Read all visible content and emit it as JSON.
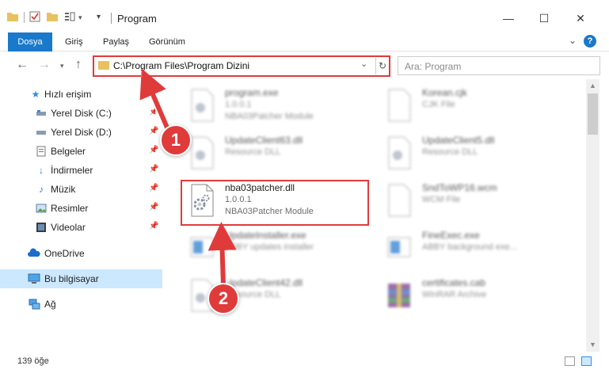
{
  "window": {
    "title": "Program",
    "minimize_icon": "minimize-icon",
    "maximize_icon": "maximize-icon",
    "close_icon": "close-icon"
  },
  "ribbon": {
    "tabs": [
      "Dosya",
      "Giriş",
      "Paylaş",
      "Görünüm"
    ],
    "help_label": "?"
  },
  "nav": {
    "address": "C:\\Program Files\\Program Dizini",
    "search_placeholder": "Ara: Program"
  },
  "sidebar": {
    "items": [
      {
        "label": "Hızlı erişim",
        "icon": "star-icon",
        "pinned": false
      },
      {
        "label": "Yerel Disk (C:)",
        "icon": "drive-icon",
        "pinned": true
      },
      {
        "label": "Yerel Disk (D:)",
        "icon": "drive-icon",
        "pinned": true
      },
      {
        "label": "Belgeler",
        "icon": "document-icon",
        "pinned": true
      },
      {
        "label": "İndirmeler",
        "icon": "download-icon",
        "pinned": true
      },
      {
        "label": "Müzik",
        "icon": "music-icon",
        "pinned": true
      },
      {
        "label": "Resimler",
        "icon": "picture-icon",
        "pinned": true
      },
      {
        "label": "Videolar",
        "icon": "video-icon",
        "pinned": true
      },
      {
        "label": "OneDrive",
        "icon": "cloud-icon",
        "pinned": false
      },
      {
        "label": "Bu bilgisayar",
        "icon": "computer-icon",
        "pinned": false,
        "selected": true
      },
      {
        "label": "Ağ",
        "icon": "network-icon",
        "pinned": false
      }
    ]
  },
  "files": [
    {
      "name": "program.exe",
      "ver": "1.0.0.1",
      "desc": "NBA03Patcher Module",
      "blurred": true
    },
    {
      "name": "Korean.cjk",
      "ver": "CJK File",
      "desc": "",
      "blurred": true
    },
    {
      "name": "UpdateClient63.dll",
      "ver": "Resource DLL",
      "desc": "",
      "blurred": true
    },
    {
      "name": "UpdateClient5.dll",
      "ver": "Resource DLL",
      "desc": "",
      "blurred": true
    },
    {
      "name": "nba03patcher.dll",
      "ver": "1.0.0.1",
      "desc": "NBA03Patcher Module",
      "blurred": false
    },
    {
      "name": "SndToWP16.wcm",
      "ver": "WCM File",
      "desc": "",
      "blurred": true
    },
    {
      "name": "UpdateInstaller.exe",
      "ver": "ABBY updates installer",
      "desc": "",
      "blurred": true
    },
    {
      "name": "FineExec.exe",
      "ver": "ABBY background exe...",
      "desc": "",
      "blurred": true
    },
    {
      "name": "UpdateClient42.dll",
      "ver": "Resource DLL",
      "desc": "",
      "blurred": true
    },
    {
      "name": "certificates.cab",
      "ver": "WinRAR Archive",
      "desc": "",
      "blurred": true
    }
  ],
  "status": {
    "item_count": "139 öğe"
  },
  "annotations": {
    "step1": "1",
    "step2": "2"
  },
  "colors": {
    "accent": "#1979ca",
    "highlight": "#e03b3b",
    "selected_bg": "#cce8ff"
  }
}
